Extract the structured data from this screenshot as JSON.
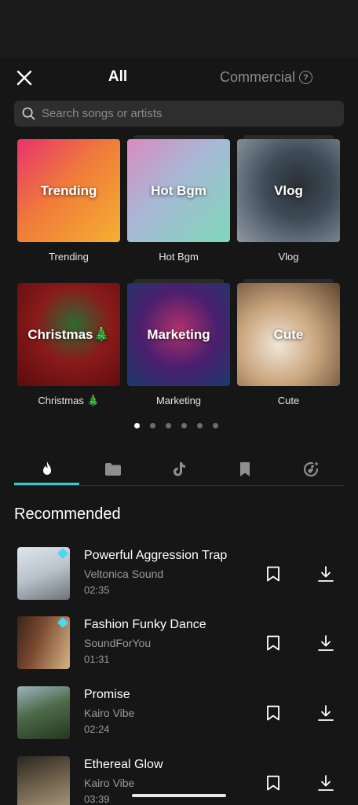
{
  "header": {
    "tab_all": "All",
    "tab_commercial": "Commercial",
    "help_glyph": "?"
  },
  "search": {
    "placeholder": "Search songs or artists"
  },
  "categories": [
    {
      "title": "Trending",
      "caption": "Trending",
      "colors": [
        "#e23a6b",
        "#f5a623"
      ]
    },
    {
      "title": "Hot Bgm",
      "caption": "Hot Bgm",
      "colors": [
        "#e58fb6",
        "#7fd3c0"
      ]
    },
    {
      "title": "Vlog",
      "caption": "Vlog",
      "colors": [
        "#4a5a68",
        "#c9ccd1"
      ]
    },
    {
      "title": "Christmas🎄",
      "caption": "Christmas 🎄",
      "colors": [
        "#7a0f12",
        "#c73a2b"
      ]
    },
    {
      "title": "Marketing",
      "caption": "Marketing",
      "colors": [
        "#3b1a5e",
        "#1d4a7a"
      ]
    },
    {
      "title": "Cute",
      "caption": "Cute",
      "colors": [
        "#8a6a4d",
        "#e8d7c3"
      ]
    }
  ],
  "pager": {
    "count": 6,
    "active": 0
  },
  "icon_tabs": [
    {
      "icon": "flame-icon",
      "active": true
    },
    {
      "icon": "folder-icon",
      "active": false
    },
    {
      "icon": "tiktok-icon",
      "active": false
    },
    {
      "icon": "bookmark-icon",
      "active": false
    },
    {
      "icon": "music-sparkle-icon",
      "active": false
    }
  ],
  "section_title": "Recommended",
  "tracks": [
    {
      "title": "Powerful Aggression Trap",
      "artist": "Veltonica Sound",
      "duration": "02:35",
      "premium": true,
      "colors": [
        "#c9d3dc",
        "#8b8f96"
      ]
    },
    {
      "title": "Fashion Funky Dance",
      "artist": "SoundForYou",
      "duration": "01:31",
      "premium": true,
      "colors": [
        "#6b3b2a",
        "#d7b48a"
      ]
    },
    {
      "title": "Promise",
      "artist": "Kairo Vibe",
      "duration": "02:24",
      "premium": false,
      "colors": [
        "#2f4f2f",
        "#8fa8b8"
      ]
    },
    {
      "title": "Ethereal Glow",
      "artist": "Kairo Vibe",
      "duration": "03:39",
      "premium": false,
      "colors": [
        "#4a4038",
        "#9a8a70"
      ]
    }
  ],
  "theme": {
    "accent": "#3ec6d2",
    "background": "#161616",
    "search_bg": "#2e2e2e"
  }
}
